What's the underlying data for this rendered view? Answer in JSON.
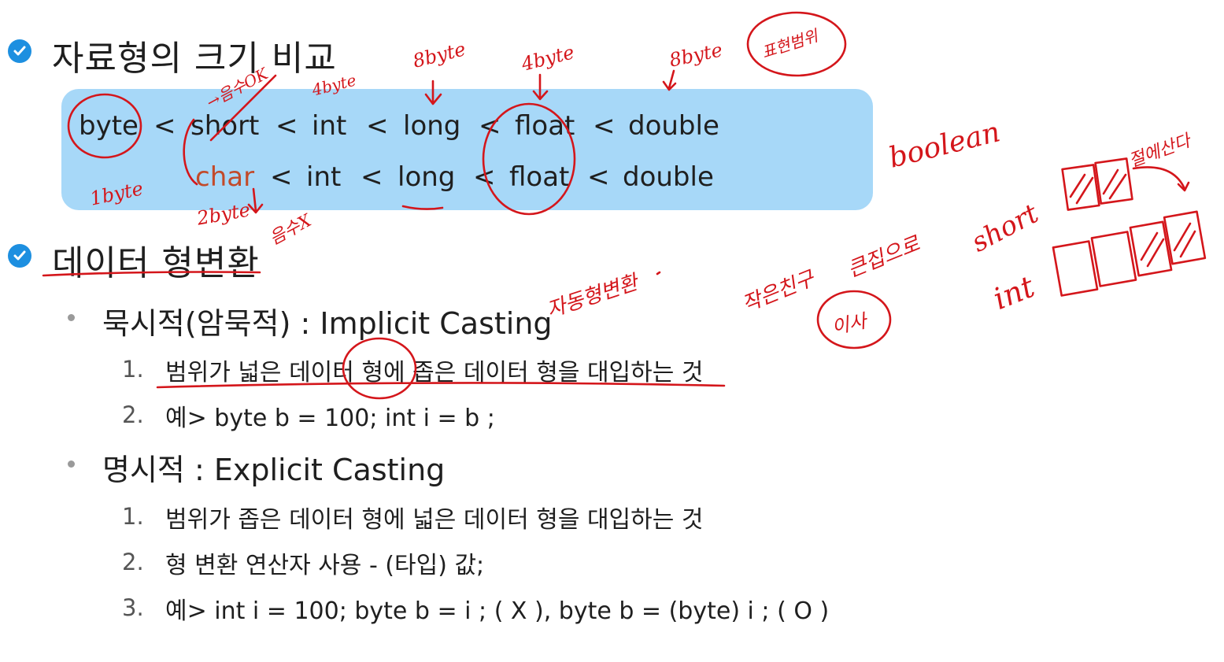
{
  "section1": {
    "title": "자료형의 크기 비교",
    "icon": "check-icon"
  },
  "row1": [
    "byte",
    "<",
    "short",
    "<",
    "int",
    "<",
    "long",
    "<",
    "float",
    "<",
    "double"
  ],
  "row2": [
    "char",
    "<",
    "int",
    "<",
    "long",
    "<",
    "float",
    "<",
    "double"
  ],
  "section2": {
    "title": "데이터 형변환",
    "icon": "check-icon"
  },
  "implicit": {
    "title": "묵시적(암묵적) : Implicit Casting",
    "items": [
      {
        "num": "1.",
        "text": "범위가 넓은 데이터 형에 좁은 데이터 형을 대입하는 것"
      },
      {
        "num": "2.",
        "text": "예> byte b = 100;   int  i  =  b ;"
      }
    ]
  },
  "explicit": {
    "title": "명시적 : Explicit Casting",
    "items": [
      {
        "num": "1.",
        "text": "범위가 좁은 데이터 형에 넓은 데이터 형을 대입하는 것"
      },
      {
        "num": "2.",
        "text": "형 변환 연산자 사용  -   (타입) 값;"
      },
      {
        "num": "3.",
        "text": "예> int i = 100;   byte  b  =  i ;  ( X ),     byte  b  =  (byte) i ;  ( O )"
      }
    ]
  },
  "handwriting": {
    "short_note": "→음수OK",
    "byte1": "1byte",
    "byte2": "2byte",
    "byte4a": "4byte",
    "byte8a": "8byte",
    "byte4b": "4byte",
    "byte8b": "8byte",
    "char_note": "음수X",
    "range": "표현범위",
    "boolean": "boolean",
    "auto": "자동형변환",
    "small": "작은친구",
    "big": "큰집으로",
    "move": "이사",
    "short": "short",
    "int": "int",
    "calc": "절에산다"
  },
  "colors": {
    "accent": "#1d8fe0",
    "box": "#a7d8f8",
    "ink": "#d4161b",
    "char": "#c24a2a"
  }
}
